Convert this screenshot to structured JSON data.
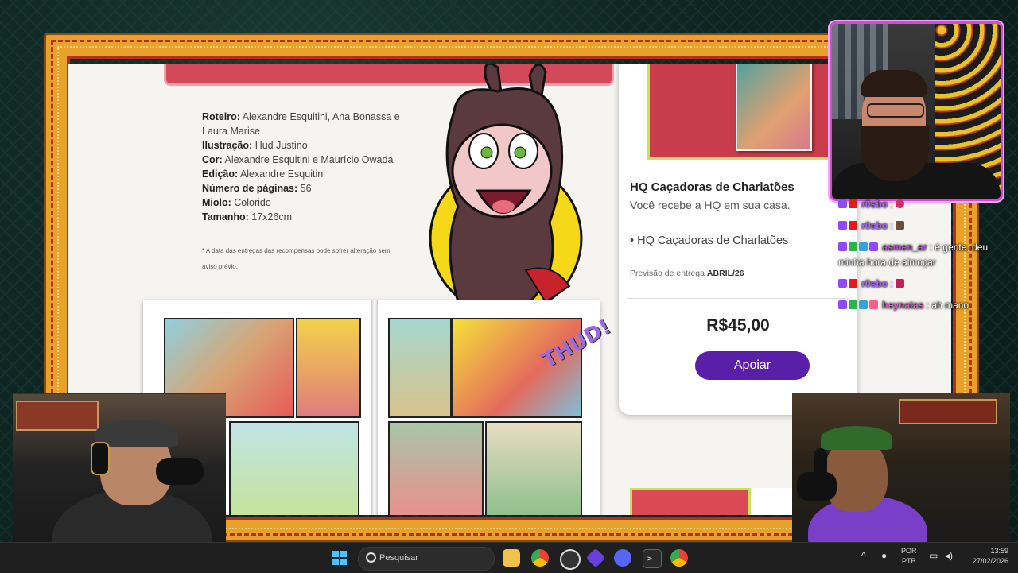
{
  "credits": {
    "roteiro_label": "Roteiro:",
    "roteiro_value": " Alexandre Esquitini, Ana Bonassa e Laura Marise",
    "ilustracao_label": "Ilustração:",
    "ilustracao_value": " Hud Justino",
    "cor_label": "Cor:",
    "cor_value": " Alexandre Esquitini e Maurício Owada",
    "edicao_label": "Edição:",
    "edicao_value": " Alexandre Esquitini",
    "paginas_label": "Número de páginas:",
    "paginas_value": " 56",
    "miolo_label": "Miolo:",
    "miolo_value": " Colorido",
    "tamanho_label": "Tamanho:",
    "tamanho_value": " 17x26cm",
    "note": "* A data das entregas das recompensas pode sofrer alteração sem aviso prévio."
  },
  "reward": {
    "title": "HQ Caçadoras de Charlatões",
    "description": "Você recebe a HQ em sua casa.",
    "item": "• HQ Caçadoras de Charlatões",
    "delivery_label": "Previsão de entrega ",
    "delivery_value": "ABRIL/26",
    "price": "R$45,00",
    "button": "Apoiar"
  },
  "comic": {
    "sfx": "THUD!"
  },
  "chat": [
    {
      "user": "r0sbo",
      "text": "",
      "color": "#a76af0"
    },
    {
      "user": "r0sbo",
      "text": "",
      "color": "#a76af0"
    },
    {
      "user": "asmen_ar",
      "text": "é gente, deu minha hora de almoçar",
      "color": "#c04adf"
    },
    {
      "user": "r0sbo",
      "text": "",
      "color": "#a76af0"
    },
    {
      "user": "heynatas",
      "text": "ah mano",
      "color": "#e05ad0"
    }
  ],
  "taskbar": {
    "search_placeholder": "Pesquisar",
    "lang_top": "POR",
    "lang_bottom": "PTB",
    "time": "13:59",
    "date": "27/02/2026"
  },
  "colors": {
    "frame": "#e8a22c",
    "button": "#5a1fa8",
    "cam_border": "#d44ad8"
  }
}
